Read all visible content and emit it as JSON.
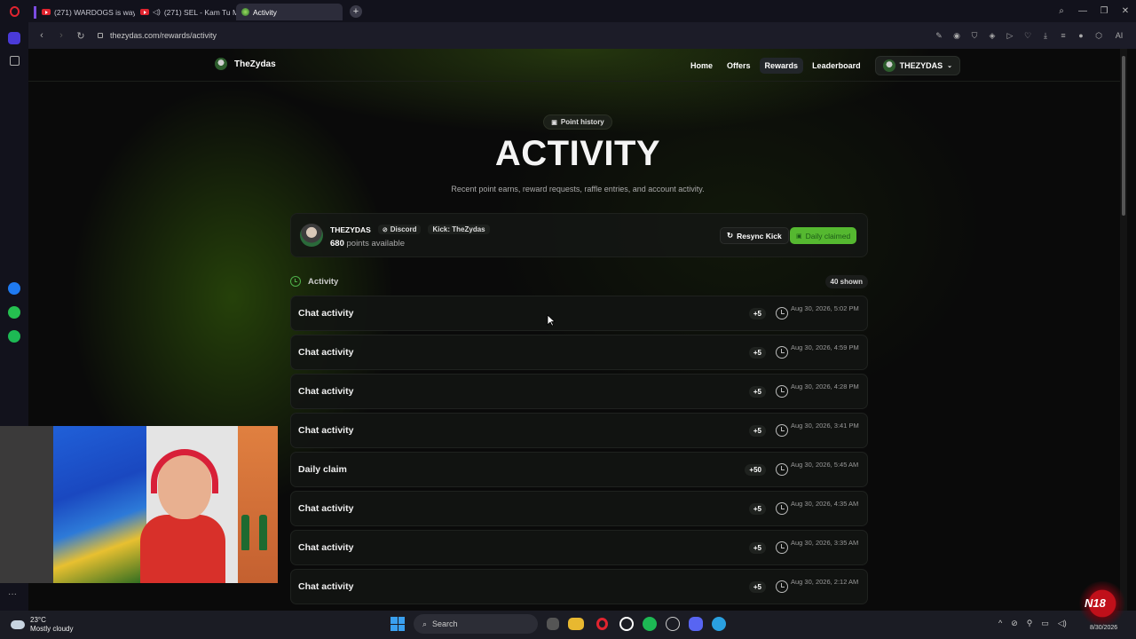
{
  "browser": {
    "tabs": [
      {
        "label": "(271) WARDOGS is way b",
        "type": "youtube"
      },
      {
        "label": "(271) SEL - Kam Tu M",
        "type": "youtube-audio"
      },
      {
        "label": "Activity",
        "type": "active"
      }
    ],
    "url": "thezydas.com/rewards/activity"
  },
  "site": {
    "brand": "TheZydas",
    "nav": [
      "Home",
      "Offers",
      "Rewards",
      "Leaderboard"
    ],
    "active_nav": "Rewards",
    "user_menu": "THEZYDAS"
  },
  "hero": {
    "eyebrow": "Point history",
    "title": "ACTIVITY",
    "subtitle": "Recent point earns, reward requests, raffle entries, and account activity."
  },
  "user_card": {
    "name": "THEZYDAS",
    "discord_tag": "Discord",
    "kick_tag": "Kick: TheZydas",
    "points_value": "680",
    "points_label": "points available",
    "resync_label": "Resync Kick",
    "claimed_label": "Daily claimed"
  },
  "activity": {
    "title": "Activity",
    "shown": "40 shown",
    "rows": [
      {
        "label": "Chat activity",
        "points": "+5",
        "time": "Aug 30, 2026, 5:02 PM"
      },
      {
        "label": "Chat activity",
        "points": "+5",
        "time": "Aug 30, 2026, 4:59 PM"
      },
      {
        "label": "Chat activity",
        "points": "+5",
        "time": "Aug 30, 2026, 4:28 PM"
      },
      {
        "label": "Chat activity",
        "points": "+5",
        "time": "Aug 30, 2026, 3:41 PM"
      },
      {
        "label": "Daily claim",
        "points": "+50",
        "time": "Aug 30, 2026, 5:45 AM"
      },
      {
        "label": "Chat activity",
        "points": "+5",
        "time": "Aug 30, 2026, 4:35 AM"
      },
      {
        "label": "Chat activity",
        "points": "+5",
        "time": "Aug 30, 2026, 3:35 AM"
      },
      {
        "label": "Chat activity",
        "points": "+5",
        "time": "Aug 30, 2026, 2:12 AM"
      }
    ]
  },
  "taskbar": {
    "temp": "23°C",
    "weather": "Mostly cloudy",
    "search": "Search",
    "date": "8/30/2026"
  },
  "colors": {
    "accent_green": "#55b830",
    "opera_red": "#e0242f"
  }
}
